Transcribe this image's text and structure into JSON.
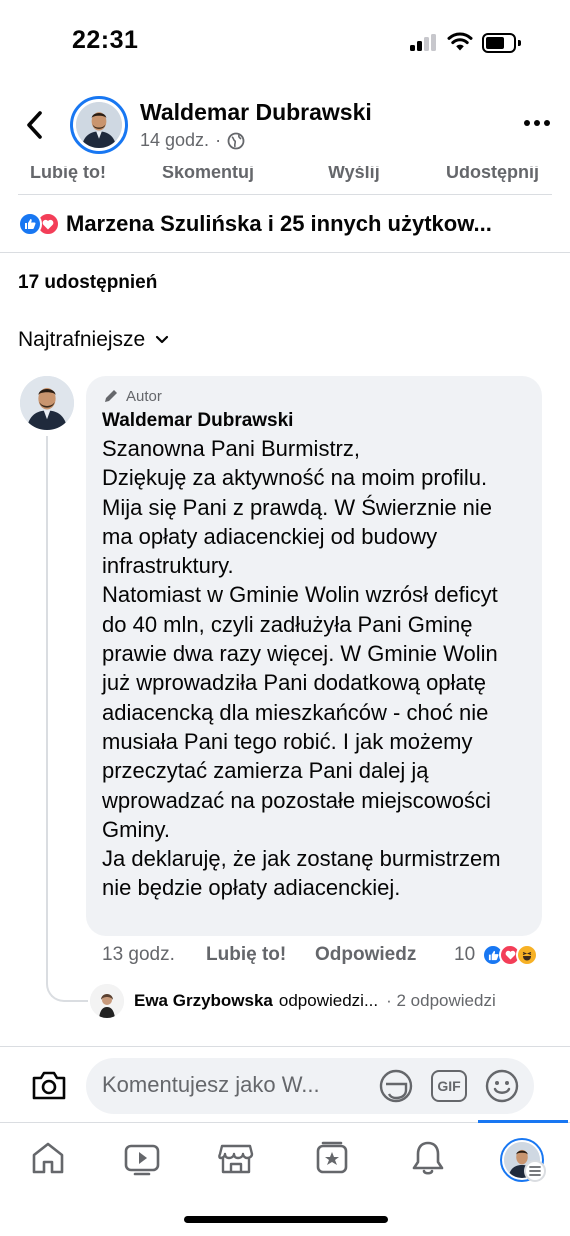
{
  "status_bar": {
    "time": "22:31"
  },
  "header": {
    "author_name": "Waldemar Dubrawski",
    "post_time": "14 godz.",
    "separator": "·"
  },
  "post_actions": {
    "like": "Lubię to!",
    "comment": "Skomentuj",
    "send": "Wyślij",
    "share": "Udostępnij"
  },
  "reactions": {
    "summary": "Marzena Szulińska i 25 innych użytkow..."
  },
  "shares": {
    "label": "17 udostępnień"
  },
  "sort": {
    "label": "Najtrafniejsze"
  },
  "comment": {
    "badge": "Autor",
    "author": "Waldemar Dubrawski",
    "text": "Szanowna Pani Burmistrz,\nDziękuję za aktywność na moim profilu. Mija się Pani z prawdą. W Świerznie nie ma opłaty adiacenckiej od budowy infrastruktury.\nNatomiast w Gminie Wolin wzrósł deficyt do 40 mln, czyli zadłużyła Pani Gminę prawie dwa razy więcej. W Gminie Wolin już wprowadziła Pani dodatkową opłatę adiacencką dla mieszkańców - choć nie musiała Pani tego robić. I jak możemy przeczytać zamierza Pani dalej ją wprowadzać na pozostałe miejscowości Gminy.\nJa deklaruję, że jak zostanę burmistrzem nie będzie opłaty adiacenckiej.",
    "time": "13 godz.",
    "like": "Lubię to!",
    "reply": "Odpowiedz",
    "reaction_count": "10"
  },
  "reply_preview": {
    "name": "Ewa Grzybowska",
    "action": "odpowiedzi...",
    "count": "· 2 odpowiedzi"
  },
  "composer": {
    "placeholder": "Komentujesz jako W...",
    "gif": "GIF"
  },
  "colors": {
    "accent": "#1877f2",
    "love": "#f33e58",
    "haha": "#f7b125",
    "text_secondary": "#65676b"
  },
  "bottom_nav": [
    "home-icon",
    "video-icon",
    "marketplace-icon",
    "feeds-icon",
    "bell-icon",
    "profile-menu"
  ]
}
